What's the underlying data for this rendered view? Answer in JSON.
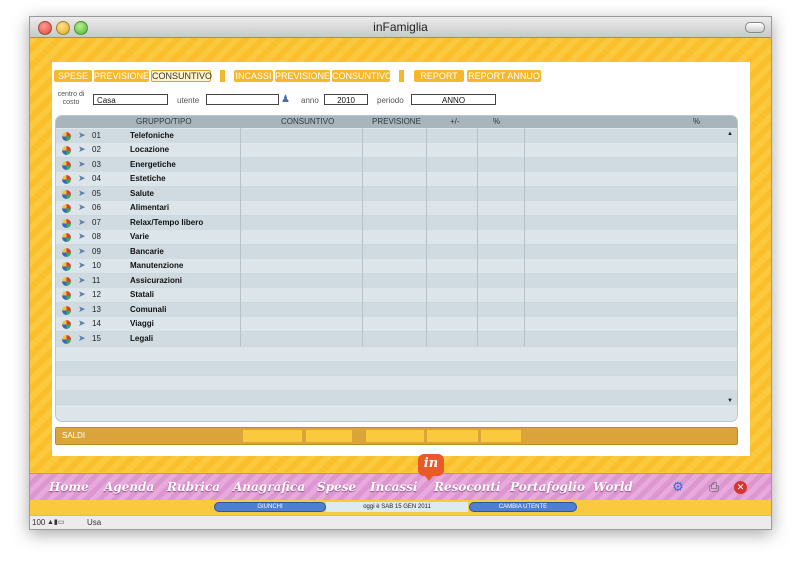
{
  "window": {
    "title": "inFamiglia"
  },
  "tabs": [
    {
      "label": "SPESE"
    },
    {
      "label": "PREVISIONE"
    },
    {
      "label": "CONSUNTIVO"
    },
    {
      "label": "INCASSI"
    },
    {
      "label": "PREVISIONE"
    },
    {
      "label": "CONSUNTIVO"
    },
    {
      "label": "REPORT"
    },
    {
      "label": "REPORT ANNUO"
    }
  ],
  "filters": {
    "centro_label": "centro di costo",
    "centro_value": "Casa",
    "utente_label": "utente",
    "utente_value": "",
    "anno_label": "anno",
    "anno_value": "2010",
    "periodo_label": "periodo",
    "periodo_value": "ANNO"
  },
  "table": {
    "headers": {
      "gruppo": "GRUPPO/TIPO",
      "consuntivo": "CONSUNTIVO",
      "previsione": "PREVISIONE",
      "diff": "+/-",
      "pct": "%",
      "pct2": "%"
    },
    "rows": [
      {
        "code": "01",
        "name": "Telefoniche"
      },
      {
        "code": "02",
        "name": "Locazione"
      },
      {
        "code": "03",
        "name": "Energetiche"
      },
      {
        "code": "04",
        "name": "Estetiche"
      },
      {
        "code": "05",
        "name": "Salute"
      },
      {
        "code": "06",
        "name": "Alimentari"
      },
      {
        "code": "07",
        "name": "Relax/Tempo libero"
      },
      {
        "code": "08",
        "name": "Varie"
      },
      {
        "code": "09",
        "name": "Bancarie"
      },
      {
        "code": "10",
        "name": "Manutenzione"
      },
      {
        "code": "11",
        "name": "Assicurazioni"
      },
      {
        "code": "12",
        "name": "Statali"
      },
      {
        "code": "13",
        "name": "Comunali"
      },
      {
        "code": "14",
        "name": "Viaggi"
      },
      {
        "code": "15",
        "name": "Legali"
      }
    ]
  },
  "saldi": {
    "label": "SALDI"
  },
  "nav": {
    "logo": "in",
    "items": [
      "Home",
      "Agenda",
      "Rubrica",
      "Anagrafica",
      "Spese",
      "Incassi",
      "Resoconti",
      "Portafoglio",
      "World"
    ]
  },
  "bottom": {
    "user_button": "GIUNCHI",
    "date_text": "oggi è   SAB 15 GEN 2011",
    "change_user": "CAMBIA UTENTE"
  },
  "status": {
    "zoom": "100",
    "mode": "Usa"
  }
}
